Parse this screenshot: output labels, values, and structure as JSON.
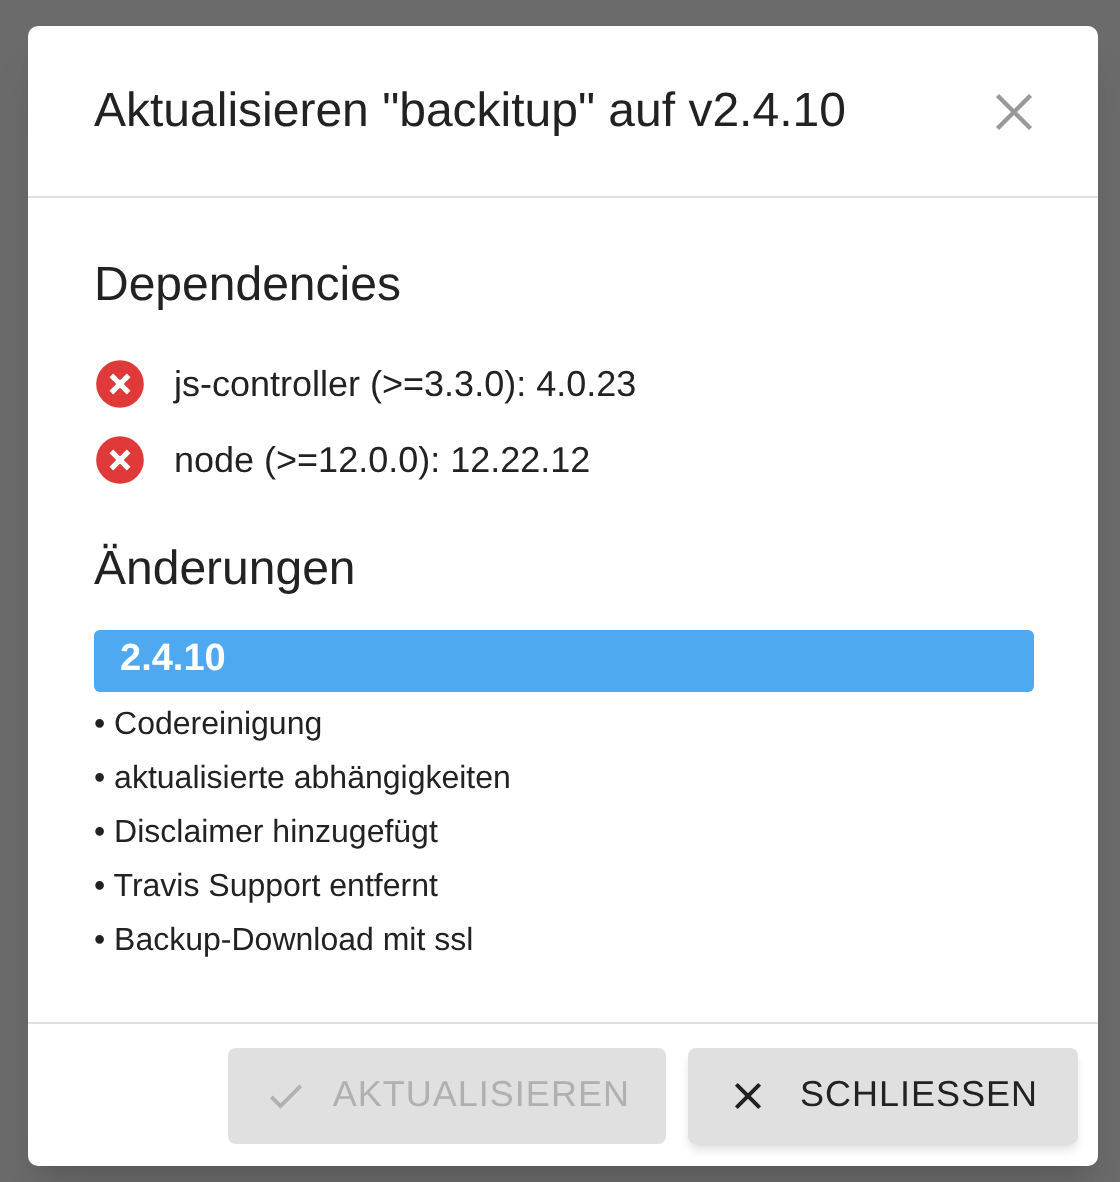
{
  "dialog": {
    "title": "Aktualisieren \"backitup\" auf v2.4.10",
    "dependencies": {
      "heading": "Dependencies",
      "items": [
        {
          "label": "js-controller (>=3.3.0): 4.0.23",
          "ok": false
        },
        {
          "label": "node (>=12.0.0): 12.22.12",
          "ok": false
        }
      ]
    },
    "changes": {
      "heading": "Änderungen",
      "versions": [
        {
          "version": "2.4.10",
          "entries": [
            "• Codereinigung",
            "• aktualisierte abhängigkeiten",
            "• Disclaimer hinzugefügt",
            "• Travis Support entfernt",
            "• Backup-Download mit ssl"
          ]
        }
      ]
    },
    "buttons": [
      {
        "label": "AKTUALISIEREN",
        "kind": "confirm",
        "disabled": true
      },
      {
        "label": "SCHLIESSEN",
        "kind": "close",
        "disabled": false
      }
    ]
  }
}
